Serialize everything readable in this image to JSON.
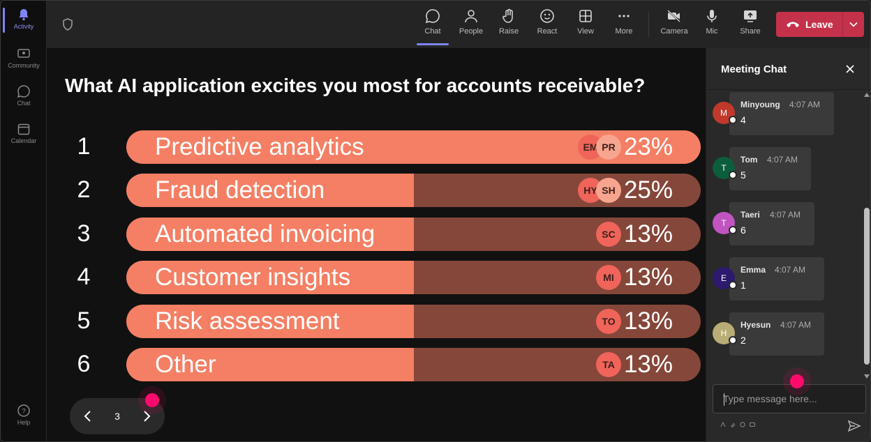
{
  "rail": {
    "items": [
      {
        "label": "Activity",
        "icon": "bell-icon",
        "active": true
      },
      {
        "label": "Community",
        "icon": "community-icon"
      },
      {
        "label": "Chat",
        "icon": "chat-icon"
      },
      {
        "label": "Calendar",
        "icon": "calendar-icon"
      }
    ],
    "help_label": "Help"
  },
  "toolbar": {
    "chat": "Chat",
    "people": "People",
    "raise": "Raise",
    "react": "React",
    "view": "View",
    "more": "More",
    "camera": "Camera",
    "mic": "Mic",
    "share": "Share",
    "leave": "Leave"
  },
  "poll": {
    "question": "What AI application excites you most for accounts receivable?",
    "options": [
      {
        "num": "1",
        "label": "Predictive analytics",
        "pct": "23%",
        "fill": 1.0,
        "avatars": [
          "EM",
          "PR"
        ]
      },
      {
        "num": "2",
        "label": "Fraud detection",
        "pct": "25%",
        "fill": 0.5,
        "avatars": [
          "HY",
          "SH"
        ]
      },
      {
        "num": "3",
        "label": "Automated invoicing",
        "pct": "13%",
        "fill": 0.5,
        "avatars": [
          "SC"
        ]
      },
      {
        "num": "4",
        "label": "Customer insights",
        "pct": "13%",
        "fill": 0.5,
        "avatars": [
          "MI"
        ]
      },
      {
        "num": "5",
        "label": "Risk assessment",
        "pct": "13%",
        "fill": 0.5,
        "avatars": [
          "TO"
        ]
      },
      {
        "num": "6",
        "label": "Other",
        "pct": "13%",
        "fill": 0.5,
        "avatars": [
          "TA"
        ]
      }
    ],
    "page": "3"
  },
  "chat": {
    "title": "Meeting Chat",
    "messages": [
      {
        "initial": "M",
        "name": "Minyoung",
        "time": "4:07 AM",
        "text": "4",
        "color": "#c0392b"
      },
      {
        "initial": "T",
        "name": "Tom",
        "time": "4:07 AM",
        "text": "5",
        "color": "#0b5d3b"
      },
      {
        "initial": "T",
        "name": "Taeri",
        "time": "4:07 AM",
        "text": "6",
        "color": "#c154c1"
      },
      {
        "initial": "E",
        "name": "Emma",
        "time": "4:07 AM",
        "text": "1",
        "color": "#2c1a6e"
      },
      {
        "initial": "H",
        "name": "Hyesun",
        "time": "4:07 AM",
        "text": "2",
        "color": "#b8ad74"
      }
    ],
    "placeholder": "Type message here..."
  },
  "colors": {
    "accent": "#7f85f5",
    "leave": "#c4314b",
    "bar_fill": "#f47f64",
    "bar_track": "#85473a",
    "pointer": "#ff0a6c"
  }
}
